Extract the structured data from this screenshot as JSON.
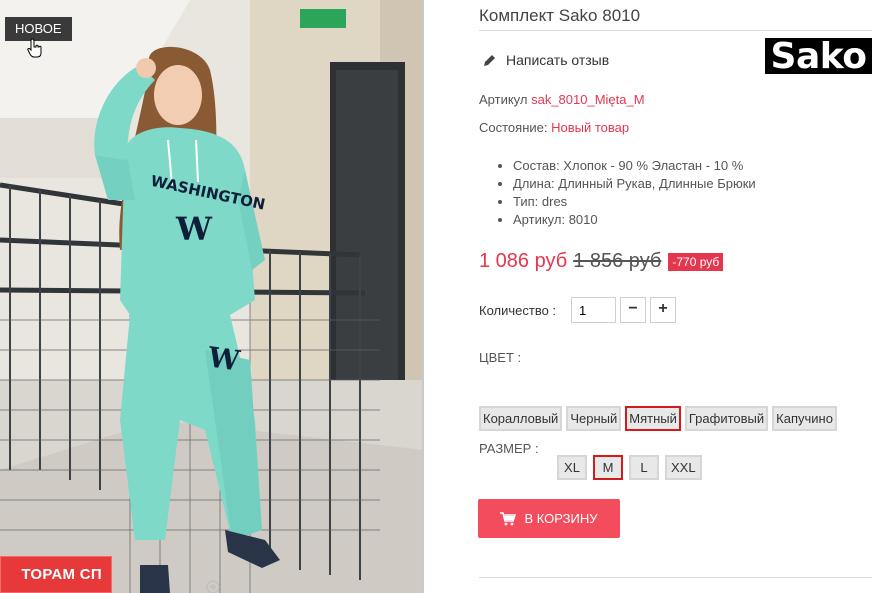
{
  "image": {
    "badge": "НОВОЕ",
    "promo_banner": "ТОРАМ СП",
    "print_text_top": "WASHINGTON",
    "print_letter": "W"
  },
  "product": {
    "title": "Комплект Sako 8010",
    "review_link": "Написать отзыв",
    "brand_logo": "Sako",
    "sku_label": "Артикул",
    "sku_value": "sak_8010_Mięta_M",
    "state_label": "Состояние:",
    "state_value": "Новый товар",
    "specs": [
      "Состав: Хлопок - 90 % Эластан - 10 %",
      "Длина: Длинный Рукав, Длинные Брюки",
      "Тип: dres",
      "Артикул: 8010"
    ],
    "price": "1 086 руб",
    "old_price": "1 856 руб",
    "discount": "-770 руб"
  },
  "quantity": {
    "label": "Количество :",
    "value": "1",
    "minus": "−",
    "plus": "+"
  },
  "color": {
    "label": "ЦВЕТ :",
    "options": [
      "Коралловый",
      "Черный",
      "Мятный",
      "Графитовый",
      "Капучино"
    ],
    "selected": "Мятный"
  },
  "size": {
    "label": "РАЗМЕР :",
    "options": [
      "XL",
      "M",
      "L",
      "XXL"
    ],
    "selected": "M"
  },
  "cart_button": "В КОРЗИНУ",
  "colors": {
    "accent": "#e5364f",
    "cart": "#f24c5d",
    "selected_border": "#d01c1c",
    "garment": "#7fd9c9"
  }
}
